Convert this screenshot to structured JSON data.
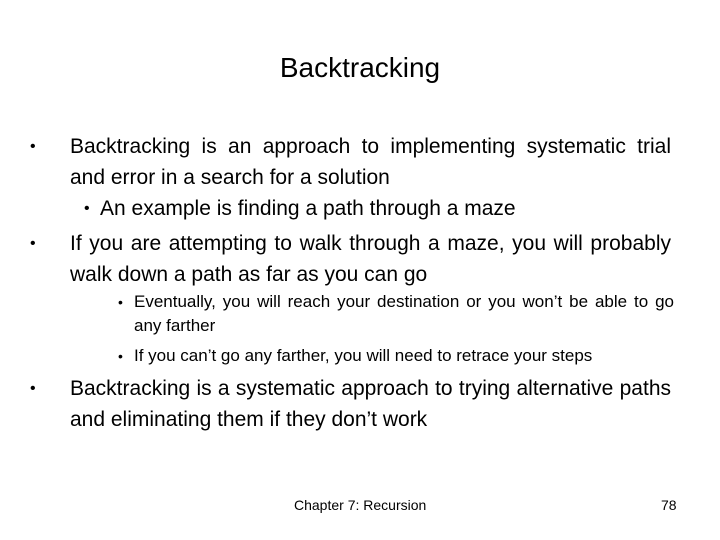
{
  "slide": {
    "title": "Backtracking",
    "bullets": [
      {
        "level": 1,
        "bullet": "•",
        "text": "Backtracking is an approach to implementing systematic trial and error in a search for a solution"
      },
      {
        "level": 2,
        "bullet": "•",
        "text": "An example is finding a path through a maze"
      },
      {
        "level": 1,
        "bullet": "•",
        "text": "If you are attempting to walk through a maze, you will probably walk down a path as far as you can go"
      },
      {
        "level": 3,
        "bullet": "•",
        "text": "Eventually, you will reach your destination or you won’t be able to go any farther"
      },
      {
        "level": 3,
        "bullet": "•",
        "text": "If you can’t go any farther, you will need to retrace your steps"
      },
      {
        "level": 1,
        "bullet": "•",
        "text": "Backtracking is a systematic approach to trying alternative paths and eliminating them if they don’t work"
      }
    ],
    "footer": {
      "chapter": "Chapter 7: Recursion",
      "page_number": "78"
    }
  }
}
